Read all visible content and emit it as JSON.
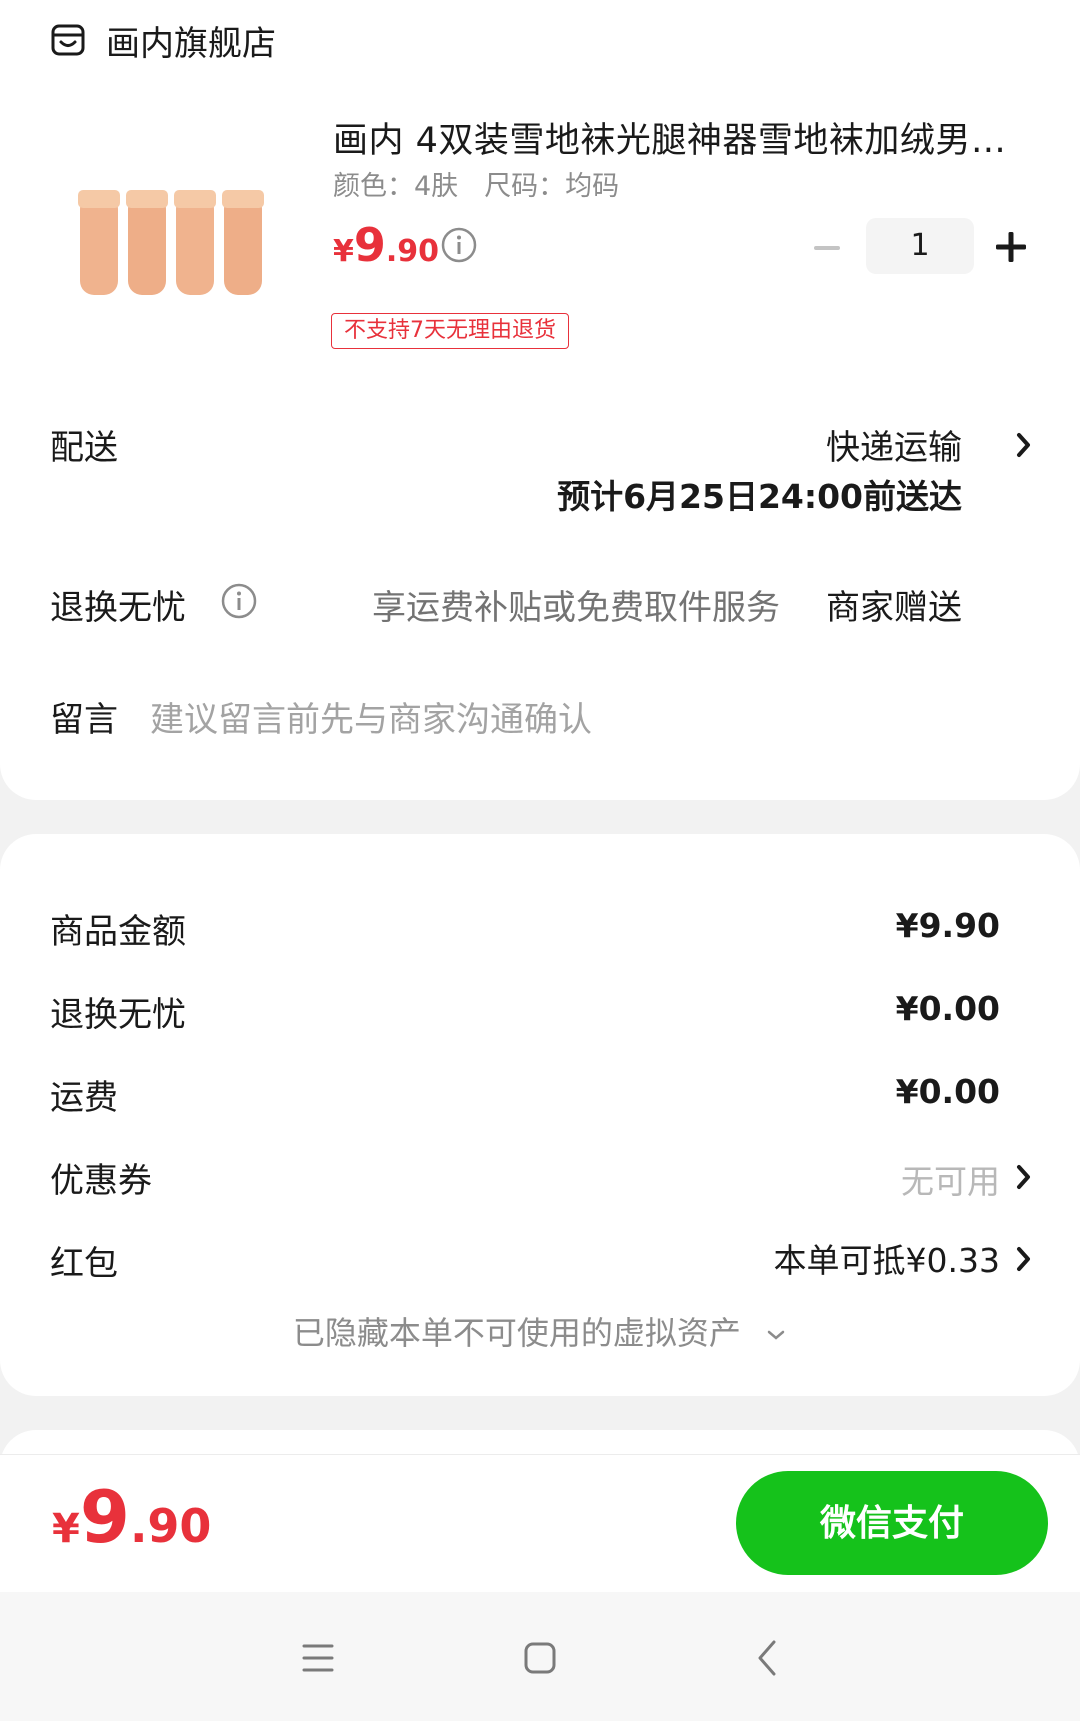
{
  "store": {
    "name": "画内旗舰店",
    "icon": "store-icon"
  },
  "product": {
    "title": "画内 4双装雪地袜光腿神器雪地袜加绒男…",
    "color": "颜色：4肤",
    "size": "尺码：均码",
    "price_currency": "¥",
    "price_int": "9",
    "price_dec": ".90",
    "quantity": "1",
    "tag": "不支持7天无理由退货"
  },
  "delivery": {
    "label": "配送",
    "method": "快递运输",
    "eta": "预计6月25日24:00前送达"
  },
  "return_worry_free": {
    "label": "退换无忧",
    "desc": "享运费补贴或免费取件服务",
    "value": "商家赠送"
  },
  "message": {
    "label": "留言",
    "placeholder": "建议留言前先与商家沟通确认"
  },
  "summary": {
    "items": [
      {
        "label": "商品金额",
        "value": "¥9.90"
      },
      {
        "label": "退换无忧",
        "value": "¥0.00"
      },
      {
        "label": "运费",
        "value": "¥0.00"
      },
      {
        "label": "优惠券",
        "value": "无可用"
      },
      {
        "label": "红包",
        "value": "本单可抵¥0.33"
      }
    ],
    "hidden_note": "已隐藏本单不可使用的虚拟资产"
  },
  "pay_bar": {
    "currency": "¥",
    "total_int": "9",
    "total_dec": ".90",
    "pay_button": "微信支付"
  },
  "colors": {
    "accent_red": "#e8313b",
    "pay_green": "#15c21b"
  }
}
